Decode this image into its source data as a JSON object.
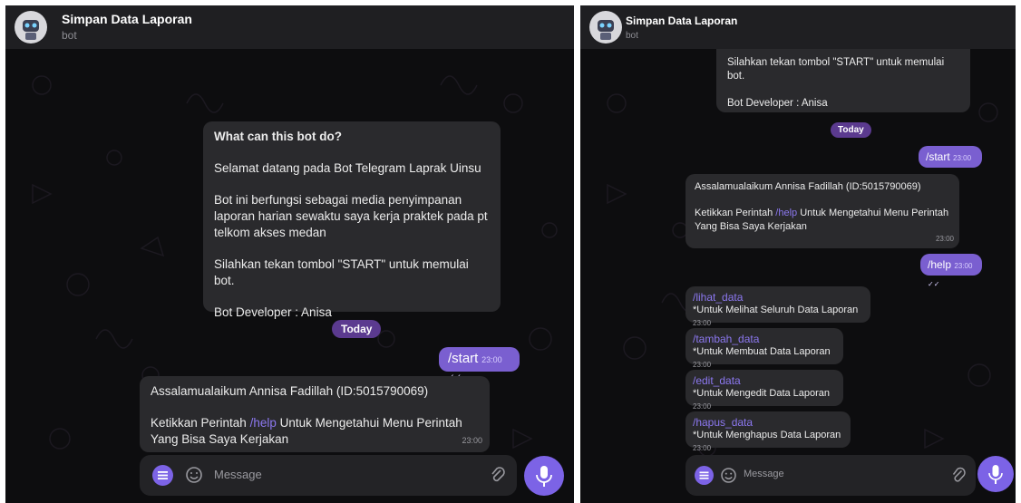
{
  "left": {
    "header": {
      "title": "Simpan Data Laporan",
      "subtitle": "bot"
    },
    "intro": {
      "heading": "What can this bot do?",
      "p1": "Selamat datang pada Bot Telegram Laprak Uinsu",
      "p2": "Bot ini berfungsi sebagai media penyimpanan laporan harian sewaktu saya kerja praktek pada pt telkom akses medan",
      "p3": "Silahkan tekan tombol \"START\" untuk memulai bot.",
      "p4": "Bot Developer : Anisa"
    },
    "today": "Today",
    "start_msg": {
      "text": "/start",
      "time": "23:00"
    },
    "reply": {
      "line1": "Assalamualaikum Annisa Fadillah (ID:5015790069)",
      "line2_pre": "Ketikkan Perintah ",
      "line2_link": "/help",
      "line2_post": " Untuk Mengetahui Menu Perintah Yang Bisa Saya Kerjakan",
      "time": "23:00"
    },
    "composer": {
      "placeholder": "Message"
    }
  },
  "right": {
    "header": {
      "title": "Simpan Data Laporan",
      "subtitle": "bot"
    },
    "intro_tail": {
      "p3": "Silahkan tekan tombol \"START\" untuk memulai bot.",
      "p4": "Bot Developer : Anisa"
    },
    "today": "Today",
    "start_msg": {
      "text": "/start",
      "time": "23:00"
    },
    "reply": {
      "line1": "Assalamualaikum Annisa Fadillah (ID:5015790069)",
      "line2_pre": "Ketikkan Perintah ",
      "line2_link": "/help",
      "line2_post": " Untuk Mengetahui Menu Perintah Yang Bisa Saya Kerjakan",
      "time": "23:00"
    },
    "help_msg": {
      "text": "/help",
      "time": "23:00"
    },
    "commands": [
      {
        "cmd": "/lihat_data",
        "desc": "*Untuk Melihat Seluruh Data Laporan",
        "time": "23:00"
      },
      {
        "cmd": "/tambah_data",
        "desc": "*Untuk Membuat Data Laporan",
        "time": "23:00"
      },
      {
        "cmd": "/edit_data",
        "desc": "*Untuk Mengedit Data Laporan",
        "time": "23:00"
      },
      {
        "cmd": "/hapus_data",
        "desc": "*Untuk Menghapus Data Laporan",
        "time": "23:00"
      }
    ],
    "composer": {
      "placeholder": "Message"
    }
  },
  "colors": {
    "background": "#0d0d0f",
    "bubble_in": "#2a2a2d",
    "bubble_out": "#7a5fd0",
    "accent": "#7c63e6",
    "link": "#8c78f0"
  }
}
